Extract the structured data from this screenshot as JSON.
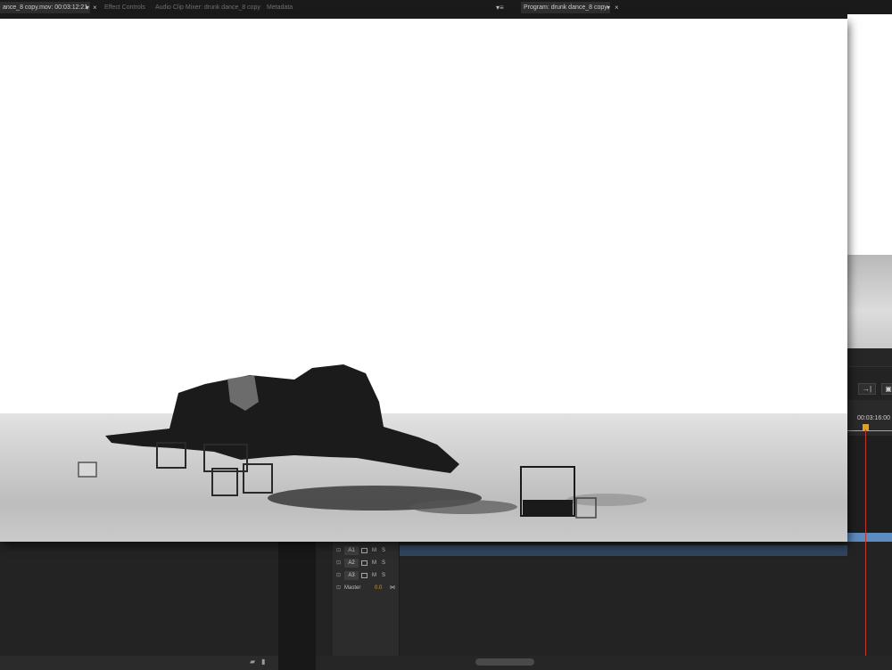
{
  "tabs": {
    "source": "ance_8 copy.mov: 00:03:12:21",
    "effect_controls": "Effect Controls",
    "audio_clip_mixer": "Audio Clip Mixer: drunk dance_8 copy",
    "metadata": "Metadata",
    "program": "Program: drunk dance_8 copy",
    "menu_glyph": "▾",
    "close_glyph": "×",
    "panel_menu_glyph": "▾≡"
  },
  "program": {
    "timecode": "00:03:16:00"
  },
  "tracks": [
    {
      "name": "A1",
      "mute": "M",
      "solo": "S"
    },
    {
      "name": "A2",
      "mute": "M",
      "solo": "S"
    },
    {
      "name": "A3",
      "mute": "M",
      "solo": "S"
    }
  ],
  "master": {
    "label": "Master",
    "value": "0.0"
  },
  "colors": {
    "accent_playhead": "#c0392b",
    "playhead_marker": "#e0a020",
    "clip_blue": "#5d8cc0",
    "master_value": "#d69a2a"
  },
  "icons": {
    "lock": "lock-icon",
    "waveform": "waveform-icon",
    "new-bin": "new-bin-icon",
    "trash": "trash-icon",
    "insert": "insert-icon",
    "export-frame": "export-frame-icon"
  }
}
